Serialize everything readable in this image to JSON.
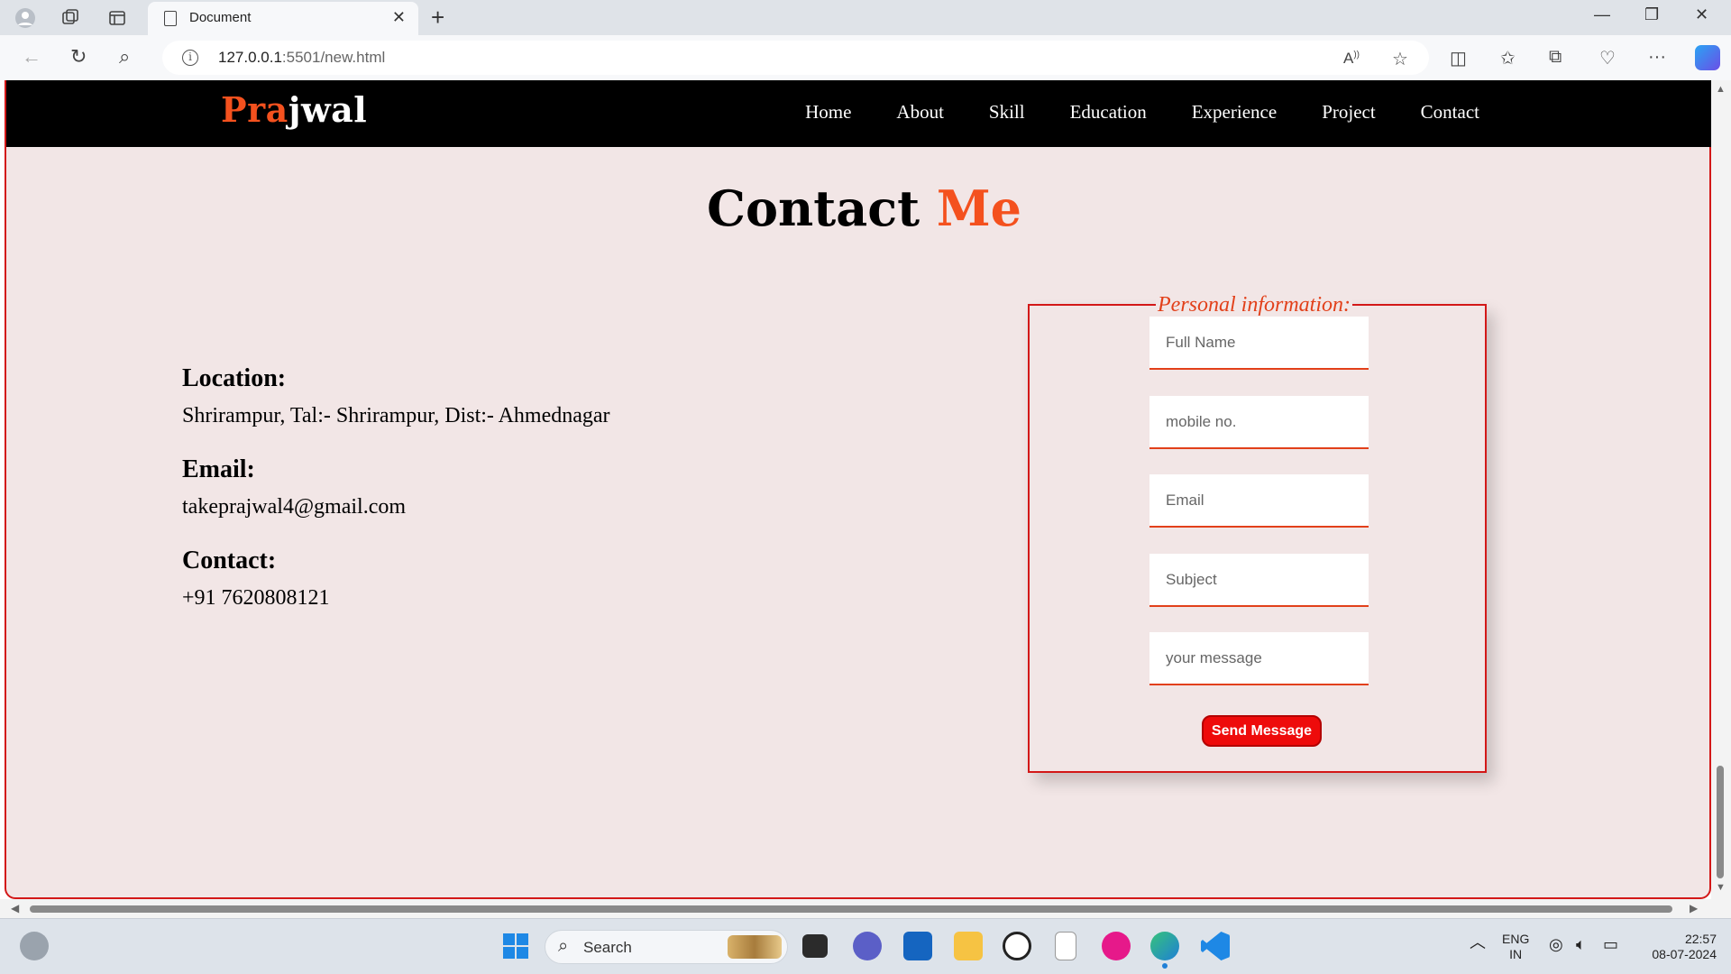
{
  "browser": {
    "tab_title": "Document",
    "url_host": "127.0.0.1",
    "url_rest": ":5501/new.html"
  },
  "site": {
    "logo_accent": "Pra",
    "logo_rest": "jwal",
    "nav": [
      "Home",
      "About",
      "Skill",
      "Education",
      "Experience",
      "Project",
      "Contact"
    ]
  },
  "page": {
    "heading_main": "Contact",
    "heading_accent": "Me"
  },
  "contact_info": {
    "location_label": "Location:",
    "location_value": "Shrirampur, Tal:- Shrirampur, Dist:- Ahmednagar",
    "email_label": "Email:",
    "email_value": "takeprajwal4@gmail.com",
    "contact_label": "Contact:",
    "contact_value": "+91 7620808121"
  },
  "form": {
    "legend": "Personal information:",
    "fullname_placeholder": "Full Name",
    "mobile_placeholder": "mobile no.",
    "email_placeholder": "Email",
    "subject_placeholder": "Subject",
    "message_placeholder": "your message",
    "submit_label": "Send Message"
  },
  "taskbar": {
    "search_label": "Search",
    "lang_top": "ENG",
    "lang_bottom": "IN",
    "time": "22:57",
    "date": "08-07-2024"
  },
  "colors": {
    "accent": "#f4511e",
    "border": "#d31818",
    "page_bg": "#f2e6e6",
    "button": "#ee0b0b"
  }
}
